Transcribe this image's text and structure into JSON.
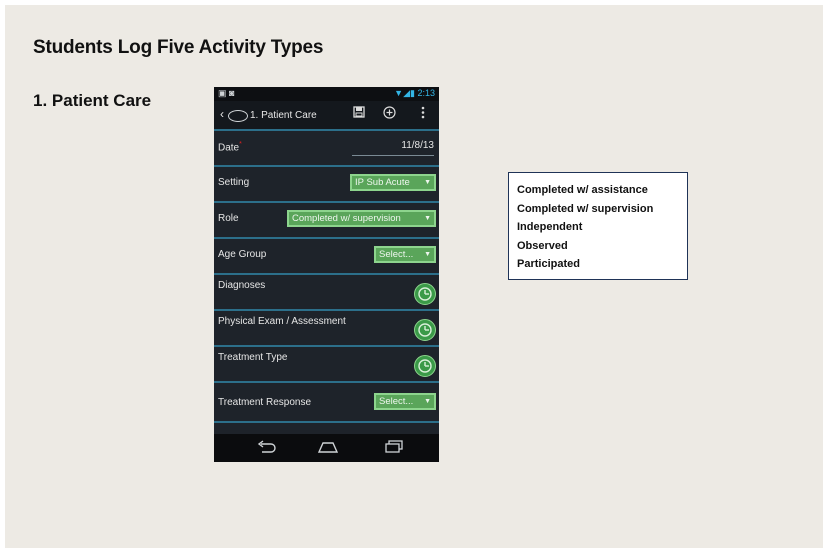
{
  "slide": {
    "title": "Students Log Five Activity Types",
    "section": "1. Patient Care"
  },
  "phone": {
    "status_time": "2:13",
    "actionbar": {
      "title": "1. Patient Care",
      "icons": [
        "back-arrow-icon",
        "save-icon",
        "add-circle-icon",
        "overflow-menu-icon"
      ]
    },
    "form": {
      "date_label": "Date",
      "date_value": "11/8/13",
      "setting_label": "Setting",
      "setting_value": "IP Sub Acute",
      "role_label": "Role",
      "role_value": "Completed w/ supervision",
      "age_group_label": "Age Group",
      "age_group_value": "Select...",
      "diagnoses_label": "Diagnoses",
      "physical_exam_label": "Physical Exam / Assessment",
      "treatment_type_label": "Treatment Type",
      "treatment_response_label": "Treatment Response",
      "treatment_response_value": "Select..."
    },
    "accent_colors": {
      "select_green": "#5aa55a",
      "divider_blue": "#2c6f8a",
      "status_blue": "#33b5e5"
    }
  },
  "role_options": [
    "Completed w/ assistance",
    "Completed w/ supervision",
    "Independent",
    "Observed",
    "Participated"
  ]
}
